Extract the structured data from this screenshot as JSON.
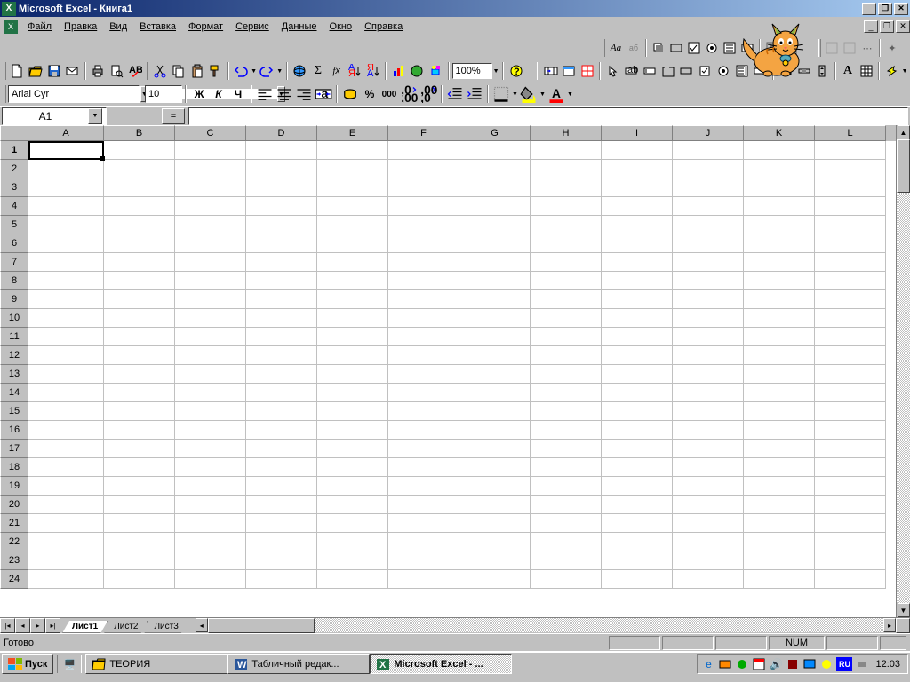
{
  "titlebar": {
    "app": "Microsoft Excel",
    "doc": "Книга1"
  },
  "menu": {
    "file": "Файл",
    "edit": "Правка",
    "view": "Вид",
    "insert": "Вставка",
    "format": "Формат",
    "tools": "Сервис",
    "data": "Данные",
    "window": "Окно",
    "help": "Справка"
  },
  "toolbar": {
    "zoom": "100%",
    "font_label": "Aa"
  },
  "format": {
    "font": "Arial Cyr",
    "size": "10",
    "bold": "Ж",
    "italic": "К",
    "underline": "Ч",
    "currency": "%"
  },
  "namebox": {
    "ref": "A1",
    "eq": "="
  },
  "columns": [
    "A",
    "B",
    "C",
    "D",
    "E",
    "F",
    "G",
    "H",
    "I",
    "J",
    "K",
    "L"
  ],
  "rows": [
    "1",
    "2",
    "3",
    "4",
    "5",
    "6",
    "7",
    "8",
    "9",
    "10",
    "11",
    "12",
    "13",
    "14",
    "15",
    "16",
    "17",
    "18",
    "19",
    "20",
    "21",
    "22",
    "23",
    "24"
  ],
  "sheets": {
    "s1": "Лист1",
    "s2": "Лист2",
    "s3": "Лист3"
  },
  "status": {
    "ready": "Готово",
    "num": "NUM"
  },
  "taskbar": {
    "start": "Пуск",
    "t1": "ТЕОРИЯ",
    "t2": "Табличный редак...",
    "t3": "Microsoft Excel - ...",
    "lang": "RU",
    "clock": "12:03"
  }
}
